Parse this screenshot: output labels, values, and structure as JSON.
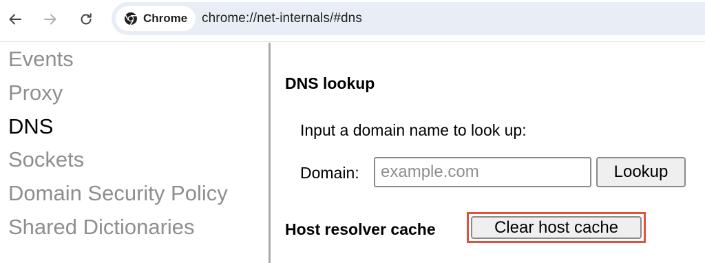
{
  "browser": {
    "back_icon": "arrow-left-icon",
    "forward_icon": "arrow-right-icon",
    "reload_icon": "reload-icon",
    "chip_label": "Chrome",
    "chip_icon": "chrome-logo-icon",
    "url": "chrome://net-internals/#dns"
  },
  "sidebar": {
    "items": [
      {
        "label": "Events"
      },
      {
        "label": "Proxy"
      },
      {
        "label": "DNS",
        "active": true
      },
      {
        "label": "Sockets"
      },
      {
        "label": "Domain Security Policy"
      },
      {
        "label": "Shared Dictionaries"
      }
    ]
  },
  "dns_lookup": {
    "heading": "DNS lookup",
    "prompt": "Input a domain name to look up:",
    "domain_label": "Domain:",
    "domain_value": "",
    "domain_placeholder": "example.com",
    "lookup_label": "Lookup"
  },
  "host_cache": {
    "heading": "Host resolver cache",
    "clear_label": "Clear host cache"
  },
  "colors": {
    "highlight": "#e2513c",
    "inactive_text": "#8e8e8e",
    "omnibox_bg": "#e9eef6"
  }
}
